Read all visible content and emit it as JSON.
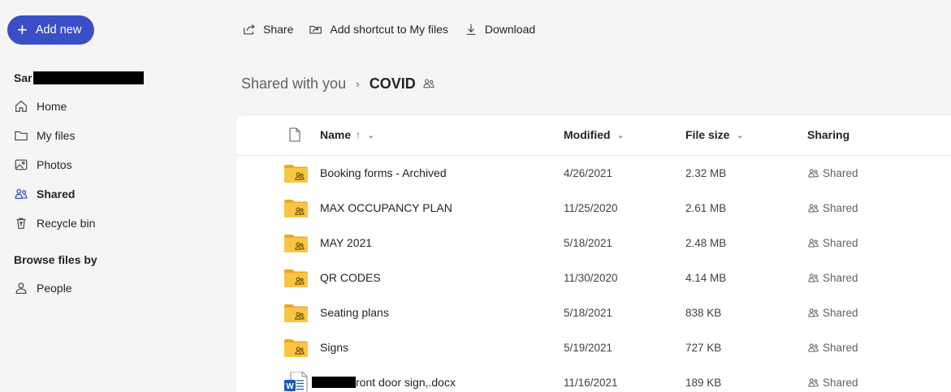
{
  "sidebar": {
    "add_new_label": "Add new",
    "account_name": "Sar",
    "nav": [
      {
        "label": "Home",
        "icon": "home-icon"
      },
      {
        "label": "My files",
        "icon": "folder-icon"
      },
      {
        "label": "Photos",
        "icon": "photos-icon"
      },
      {
        "label": "Shared",
        "icon": "people-icon",
        "active": true
      },
      {
        "label": "Recycle bin",
        "icon": "recycle-bin-icon"
      }
    ],
    "browse_heading": "Browse files by",
    "browse": [
      {
        "label": "People",
        "icon": "person-icon"
      }
    ]
  },
  "toolbar": {
    "share_label": "Share",
    "shortcut_label": "Add shortcut to My files",
    "download_label": "Download"
  },
  "breadcrumb": {
    "parent": "Shared with you",
    "current": "COVID"
  },
  "table": {
    "columns": {
      "name": "Name",
      "name_sort": "↑",
      "modified": "Modified",
      "size": "File size",
      "sharing": "Sharing"
    },
    "rows": [
      {
        "name": "Booking forms - Archived",
        "modified": "4/26/2021",
        "size": "2.32 MB",
        "sharing": "Shared",
        "type": "shared-folder"
      },
      {
        "name": "MAX OCCUPANCY PLAN",
        "modified": "11/25/2020",
        "size": "2.61 MB",
        "sharing": "Shared",
        "type": "shared-folder"
      },
      {
        "name": "MAY 2021",
        "modified": "5/18/2021",
        "size": "2.48 MB",
        "sharing": "Shared",
        "type": "shared-folder"
      },
      {
        "name": "QR CODES",
        "modified": "11/30/2020",
        "size": "4.14 MB",
        "sharing": "Shared",
        "type": "shared-folder"
      },
      {
        "name": "Seating plans",
        "modified": "5/18/2021",
        "size": "838 KB",
        "sharing": "Shared",
        "type": "shared-folder"
      },
      {
        "name": "Signs",
        "modified": "5/19/2021",
        "size": "727 KB",
        "sharing": "Shared",
        "type": "shared-folder"
      },
      {
        "name": "ront door sign,.docx",
        "modified": "11/16/2021",
        "size": "189 KB",
        "sharing": "Shared",
        "type": "word-doc"
      }
    ]
  },
  "colors": {
    "accent": "#3a4ec6",
    "folder": "#f8c642",
    "folder_tab": "#e9a924",
    "word": "#185abd"
  }
}
